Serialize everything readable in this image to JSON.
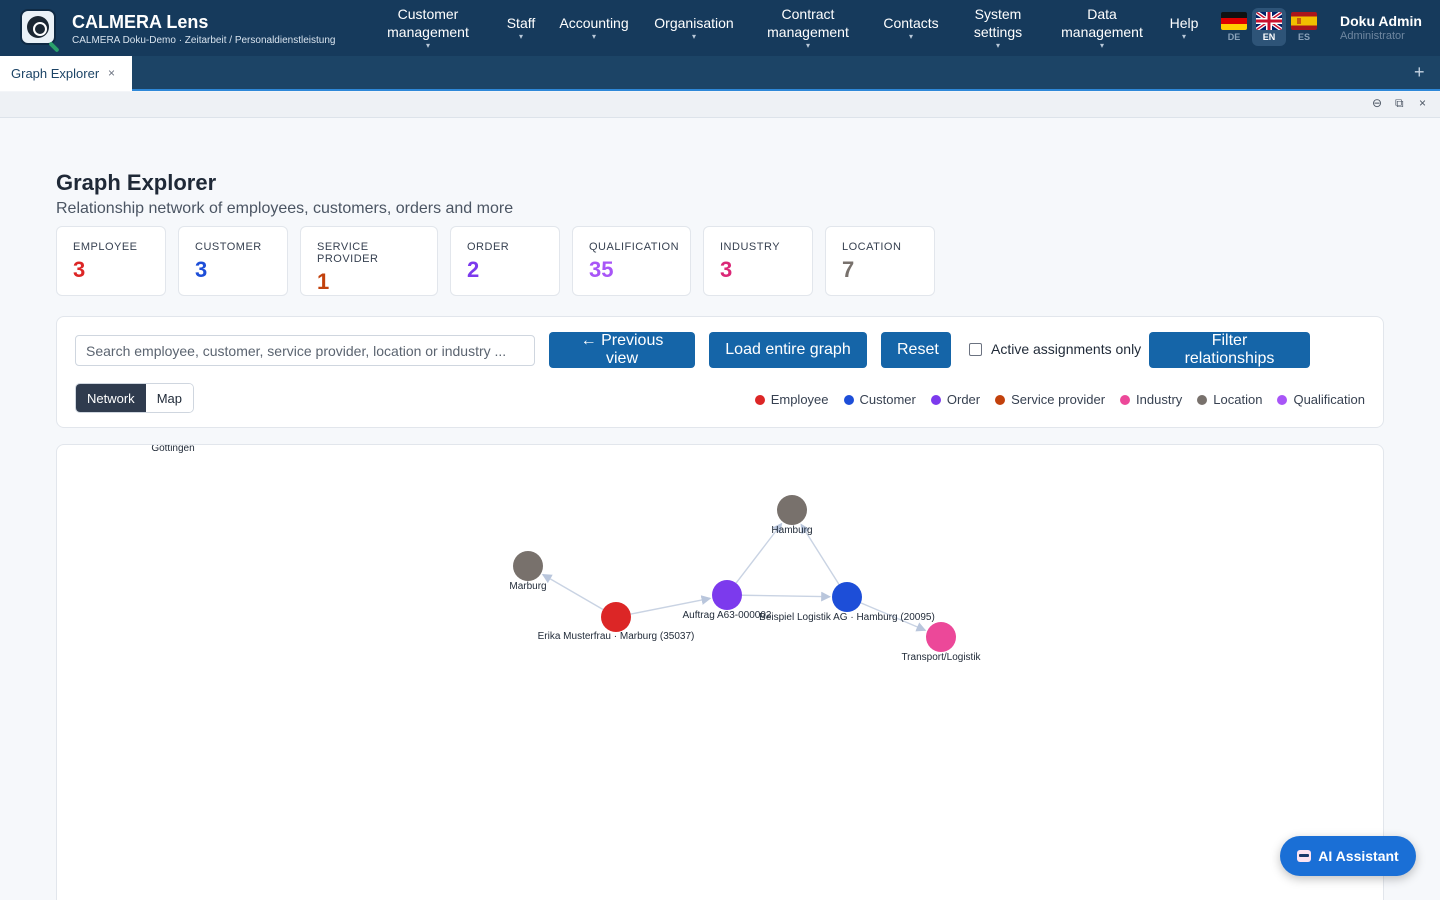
{
  "app": {
    "title": "CALMERA Lens",
    "subtitle": "CALMERA Doku-Demo · Zeitarbeit / Personaldienstleistung"
  },
  "nav": [
    {
      "label": "Customer management",
      "caret": "▾"
    },
    {
      "label": "Staff",
      "caret": "▾"
    },
    {
      "label": "Accounting",
      "caret": "▾"
    },
    {
      "label": "Organisation",
      "caret": "▾"
    },
    {
      "label": "Contract management",
      "caret": "▾"
    },
    {
      "label": "Contacts",
      "caret": "▾"
    },
    {
      "label": "System settings",
      "caret": "▾"
    },
    {
      "label": "Data management",
      "caret": "▾"
    },
    {
      "label": "Help",
      "caret": "▾"
    }
  ],
  "languages": [
    {
      "code": "DE",
      "active": false
    },
    {
      "code": "EN",
      "active": true
    },
    {
      "code": "ES",
      "active": false
    }
  ],
  "user": {
    "name": "Doku Admin",
    "role": "Administrator"
  },
  "tabs": [
    {
      "label": "Graph Explorer",
      "close": "×"
    }
  ],
  "tab_add": "+",
  "window_controls": {
    "minimize": "⊖",
    "restore": "⧉",
    "close": "×"
  },
  "page": {
    "title": "Graph Explorer",
    "subtitle": "Relationship network of employees, customers, orders and more"
  },
  "stats": [
    {
      "label": "EMPLOYEE",
      "value": "3",
      "color": "#dc2626"
    },
    {
      "label": "CUSTOMER",
      "value": "3",
      "color": "#1d4ed8"
    },
    {
      "label": "SERVICE PROVIDER",
      "value": "1",
      "color": "#c2410c"
    },
    {
      "label": "ORDER",
      "value": "2",
      "color": "#7c3aed"
    },
    {
      "label": "QUALIFICATION",
      "value": "35",
      "color": "#a855f7"
    },
    {
      "label": "INDUSTRY",
      "value": "3",
      "color": "#db2777"
    },
    {
      "label": "LOCATION",
      "value": "7",
      "color": "#78716c"
    }
  ],
  "toolbar": {
    "search_placeholder": "Search employee, customer, service provider, location or industry ...",
    "previous_view": "← Previous view",
    "load_entire_graph": "Load entire graph",
    "reset": "Reset",
    "active_only_label": "Active assignments only",
    "active_only_checked": false,
    "filter_relationships": "Filter relationships",
    "view_modes": [
      "Network",
      "Map"
    ],
    "active_view": "Network"
  },
  "legend": [
    {
      "label": "Employee",
      "color": "#dc2626"
    },
    {
      "label": "Customer",
      "color": "#1d4ed8"
    },
    {
      "label": "Order",
      "color": "#7c3aed"
    },
    {
      "label": "Service provider",
      "color": "#c2410c"
    },
    {
      "label": "Industry",
      "color": "#ec4899"
    },
    {
      "label": "Location",
      "color": "#78716c"
    },
    {
      "label": "Qualification",
      "color": "#a855f7"
    }
  ],
  "graph": {
    "nodes": [
      {
        "id": "goettingen",
        "label": "Göttingen",
        "type": "location",
        "color": "#78716c"
      },
      {
        "id": "hamburg",
        "label": "Hamburg",
        "type": "location",
        "color": "#78716c"
      },
      {
        "id": "marburg",
        "label": "Marburg",
        "type": "location",
        "color": "#78716c"
      },
      {
        "id": "erika",
        "label": "Erika Musterfrau · Marburg (35037)",
        "type": "employee",
        "color": "#dc2626"
      },
      {
        "id": "auftrag",
        "label": "Auftrag A63-000002",
        "type": "order",
        "color": "#7c3aed"
      },
      {
        "id": "beispiel",
        "label": "Beispiel Logistik AG · Hamburg (20095)",
        "type": "customer",
        "color": "#1d4ed8"
      },
      {
        "id": "transport",
        "label": "Transport/Logistik",
        "type": "industry",
        "color": "#ec4899"
      }
    ],
    "edges": [
      {
        "from": "erika",
        "to": "marburg"
      },
      {
        "from": "erika",
        "to": "auftrag"
      },
      {
        "from": "auftrag",
        "to": "hamburg"
      },
      {
        "from": "auftrag",
        "to": "beispiel"
      },
      {
        "from": "beispiel",
        "to": "hamburg"
      },
      {
        "from": "beispiel",
        "to": "transport"
      }
    ]
  },
  "ai_assistant": {
    "label": "AI Assistant"
  }
}
